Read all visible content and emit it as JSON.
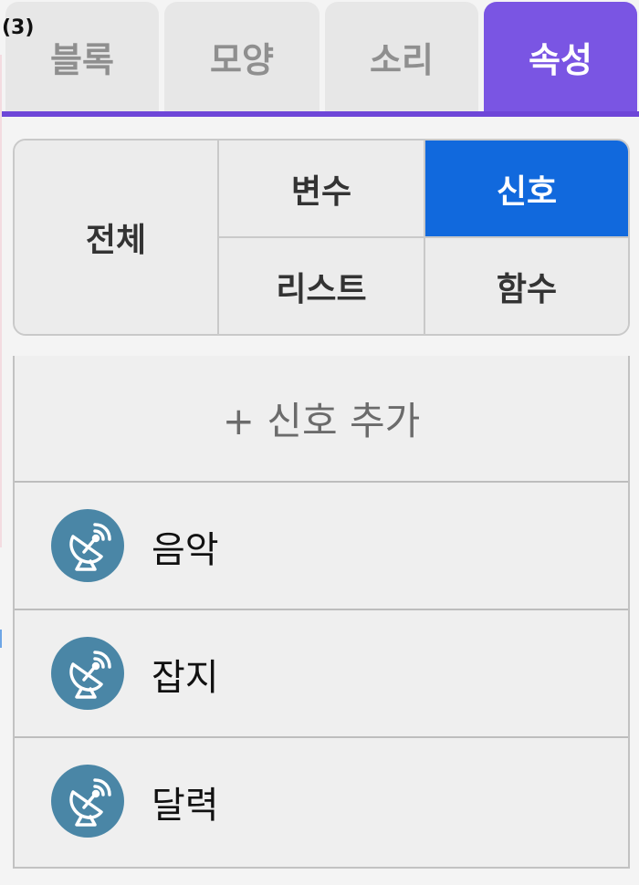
{
  "step_label": "(3)",
  "tabs": [
    {
      "label": "블록",
      "active": false
    },
    {
      "label": "모양",
      "active": false
    },
    {
      "label": "소리",
      "active": false
    },
    {
      "label": "속성",
      "active": true
    }
  ],
  "filters": {
    "all": "전체",
    "variable": "변수",
    "signal": "신호",
    "list": "리스트",
    "function": "함수",
    "selected": "signal"
  },
  "signals": {
    "add_label": "+ 신호 추가",
    "items": [
      {
        "name": "음악",
        "icon": "satellite-dish-icon"
      },
      {
        "name": "잡지",
        "icon": "satellite-dish-icon"
      },
      {
        "name": "달력",
        "icon": "satellite-dish-icon"
      }
    ]
  },
  "colors": {
    "tab_active": "#7a55e3",
    "filter_active": "#1169dd",
    "signal_icon": "#4a86a6"
  }
}
